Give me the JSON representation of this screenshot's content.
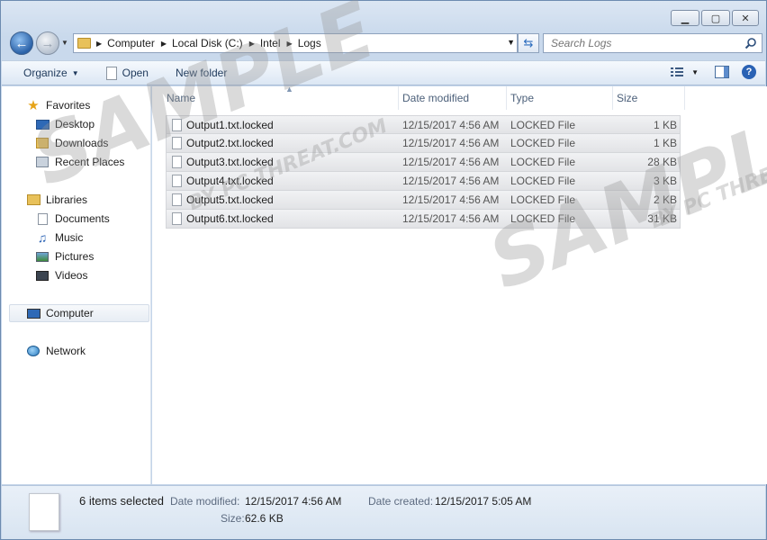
{
  "window": {
    "caption_buttons": {
      "minimize": "▁",
      "maximize": "▢",
      "close": "✕"
    }
  },
  "address": {
    "crumbs": [
      "Computer",
      "Local Disk (C:)",
      "Intel",
      "Logs"
    ]
  },
  "search": {
    "placeholder": "Search Logs"
  },
  "toolbar": {
    "organize_label": "Organize",
    "open_label": "Open",
    "new_folder_label": "New folder"
  },
  "nav_pane": {
    "favorites": "Favorites",
    "desktop": "Desktop",
    "downloads": "Downloads",
    "recent_places": "Recent Places",
    "libraries": "Libraries",
    "documents": "Documents",
    "music": "Music",
    "pictures": "Pictures",
    "videos": "Videos",
    "computer": "Computer",
    "network": "Network"
  },
  "columns": {
    "name": "Name",
    "date_modified": "Date modified",
    "type": "Type",
    "size": "Size"
  },
  "files": [
    {
      "name": "Output1.txt.locked",
      "date": "12/15/2017 4:56 AM",
      "type": "LOCKED File",
      "size": "1 KB"
    },
    {
      "name": "Output2.txt.locked",
      "date": "12/15/2017 4:56 AM",
      "type": "LOCKED File",
      "size": "1 KB"
    },
    {
      "name": "Output3.txt.locked",
      "date": "12/15/2017 4:56 AM",
      "type": "LOCKED File",
      "size": "28 KB"
    },
    {
      "name": "Output4.txt.locked",
      "date": "12/15/2017 4:56 AM",
      "type": "LOCKED File",
      "size": "3 KB"
    },
    {
      "name": "Output5.txt.locked",
      "date": "12/15/2017 4:56 AM",
      "type": "LOCKED File",
      "size": "2 KB"
    },
    {
      "name": "Output6.txt.locked",
      "date": "12/15/2017 4:56 AM",
      "type": "LOCKED File",
      "size": "31 KB"
    }
  ],
  "details": {
    "selection": "6 items selected",
    "date_modified_label": "Date modified:",
    "date_modified_value": "12/15/2017 4:56 AM",
    "date_created_label": "Date created:",
    "date_created_value": "12/15/2017 5:05 AM",
    "size_label": "Size:",
    "size_value": "62.6 KB"
  },
  "watermark": {
    "word": "SAMPLE",
    "word2": "SAMPL",
    "byline": "BY PC THREAT.COM",
    "byline2": "BY PC THRE"
  },
  "colors": {
    "accent": "#2b62a8",
    "folder": "#e8c15a",
    "selection": "#e2e3e6"
  }
}
